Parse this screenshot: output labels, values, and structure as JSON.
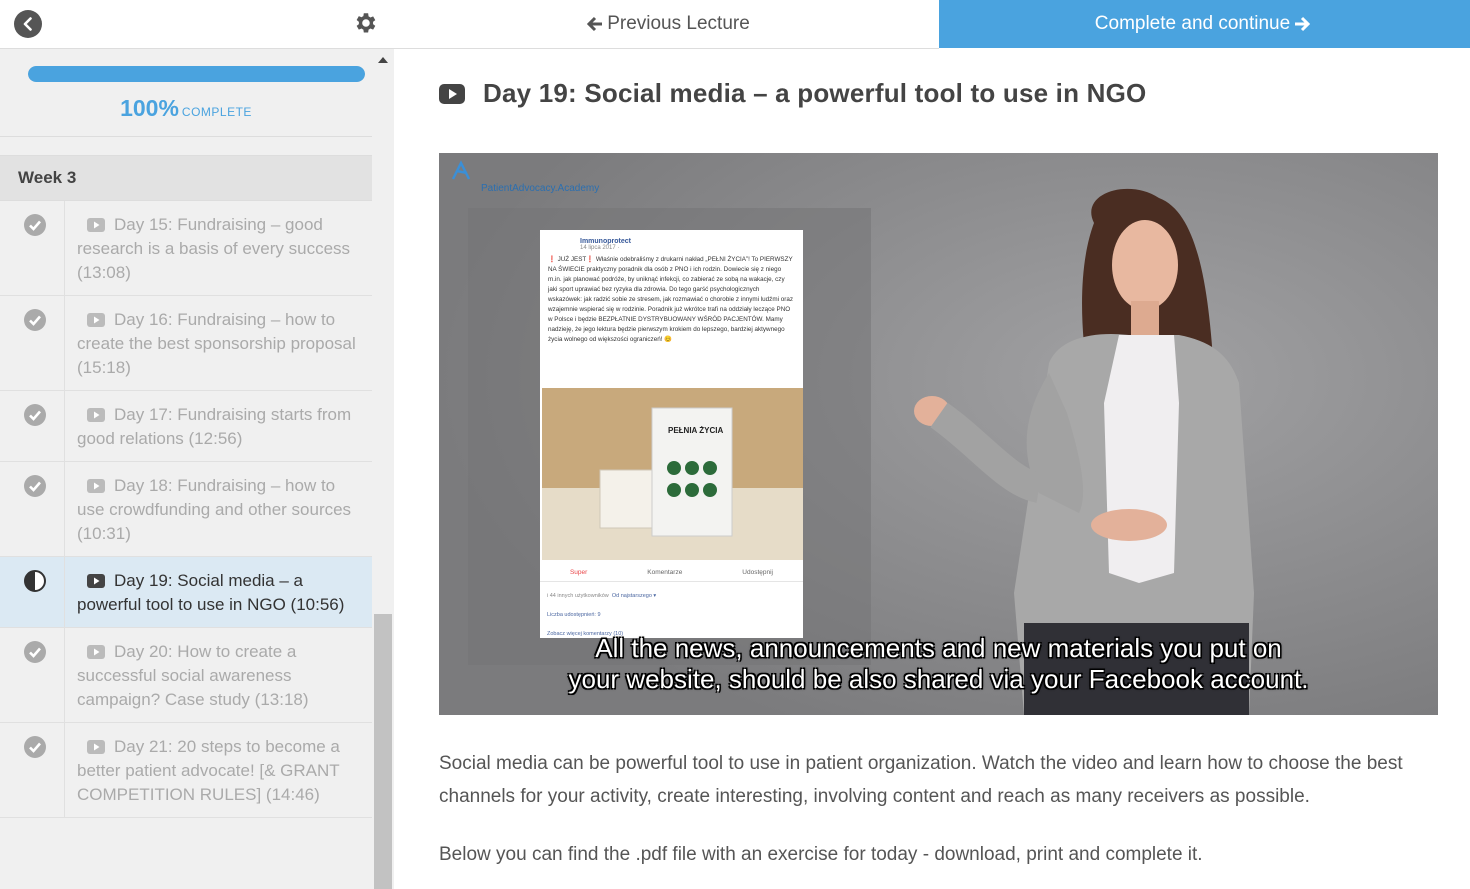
{
  "progress": {
    "percent": 100,
    "percent_text": "100%",
    "label": "COMPLETE"
  },
  "section": {
    "title": "Week 3"
  },
  "lectures": [
    {
      "title": "Day 15: Fundraising – good research is a basis of every success (13:08)",
      "status": "complete"
    },
    {
      "title": "Day 16: Fundraising – how to create the best sponsorship proposal (15:18)",
      "status": "complete"
    },
    {
      "title": "Day 17: Fundraising starts from good relations (12:56)",
      "status": "complete"
    },
    {
      "title": "Day 18: Fundraising – how to use crowdfunding and other sources (10:31)",
      "status": "complete"
    },
    {
      "title": "Day 19: Social media – a powerful tool to use in NGO (10:56)",
      "status": "in-progress"
    },
    {
      "title": "Day 20: How to create a successful social awareness campaign? Case study (13:18)",
      "status": "complete"
    },
    {
      "title": "Day 21: 20 steps to become a better patient advocate! [& GRANT COMPETITION RULES] (14:46)",
      "status": "complete"
    }
  ],
  "nav": {
    "previous_label": "Previous Lecture",
    "next_label": "Complete and continue"
  },
  "lecture": {
    "title": "Day 19: Social media – a powerful tool to use in NGO",
    "video": {
      "brand": "PatientAdvocacy.Academy",
      "subtitle_line1": "All the news, announcements and new materials you put on",
      "subtitle_line2": "your website, should be also shared via your Facebook account.",
      "fb_post": {
        "page": "Immunoprotect",
        "date": "14 lipca 2017 · ",
        "text": "❗ JUŻ JEST❗ Właśnie odebraliśmy z drukarni nakład „PEŁNI ŻYCIA”! To PIERWSZY NA ŚWIECIE praktyczny poradnik dla osób z PNO i ich rodzin. Dowiecie się z niego m.in. jak planować podróże, by uniknąć infekcji, co zabierać ze sobą na wakacje, czy jaki sport uprawiać bez ryzyka dla zdrowia. Do tego garść psychologicznych wskazówek: jak radzić sobie ze stresem, jak rozmawiać o chorobie z innymi ludźmi oraz wzajemnie wspierać się w rodzinie. Poradnik już wkrótce trafi na oddziały leczące PNO w Polsce i będzie BEZPŁATNIE DYSTRYBUOWANY WŚRÓD PACJENTÓW. Mamy nadzieję, że jego lektura będzie pierwszym krokiem do lepszego, bardziej aktywnego życia wolnego od większości ograniczeń! 😊",
        "book_title": "PEŁNIA ŻYCIA",
        "action_super": "Super",
        "action_comment": "Komentarze",
        "action_share": "Udostępnij",
        "reactions": "i 44 innych użytkowników",
        "sort": "Od najstarszego ▾",
        "shares": "Liczba udostępnień: 9",
        "more_comments": "Zobacz więcej komentarzy (10)"
      }
    },
    "description": "Social media can be powerful tool to use in patient organization. Watch the video and learn how to choose the best channels for your activity, create interesting, involving content and reach as many receivers as possible.",
    "description2": "Below you can find the .pdf file with an exercise for today - download, print and complete it."
  },
  "colors": {
    "accent": "#4aa3df",
    "active_row": "#dbe9f3",
    "sidebar_bg": "#f0f0f0"
  },
  "icons": {
    "back": "chevron-left-icon",
    "settings": "gear-icon",
    "video": "youtube-play-icon",
    "complete": "check-circle-icon",
    "in_progress": "half-circle-icon"
  }
}
